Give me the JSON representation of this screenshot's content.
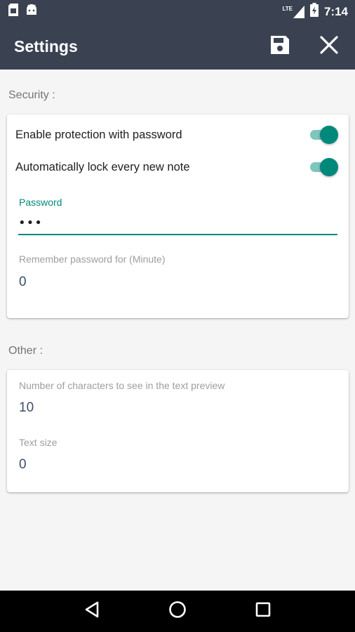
{
  "status_bar": {
    "time": "7:14",
    "network": "LTE",
    "icons": [
      "sim-card-icon",
      "android-icon",
      "signal-icon",
      "battery-icon"
    ]
  },
  "app_bar": {
    "title": "Settings",
    "actions": [
      "save-icon",
      "close-icon"
    ],
    "background": "#3a4252"
  },
  "security": {
    "header": "Security :",
    "enable_protection_label": "Enable protection with password",
    "enable_protection_on": true,
    "auto_lock_label": "Automatically lock every new note",
    "auto_lock_on": true,
    "password_label": "Password",
    "password_value": "•••",
    "remember_label": "Remember password for (Minute)",
    "remember_value": "0"
  },
  "other": {
    "header": "Other :",
    "preview_chars_label": "Number of characters to see in the text preview",
    "preview_chars_value": "10",
    "text_size_label": "Text size",
    "text_size_value": "0"
  },
  "colors": {
    "accent": "#00897b",
    "accent_light": "#7fc6bd",
    "toolbar": "#3a4252"
  },
  "nav_bar": {
    "icons": [
      "back-icon",
      "home-icon",
      "recents-icon"
    ]
  }
}
